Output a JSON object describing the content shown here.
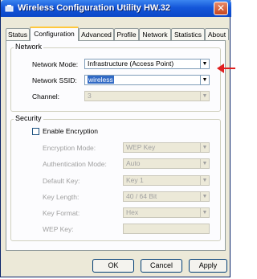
{
  "window": {
    "title": "Wireless Configuration Utility HW.32",
    "close_label": "✕"
  },
  "tabs": [
    {
      "label": "Status",
      "active": false
    },
    {
      "label": "Configuration",
      "active": true
    },
    {
      "label": "Advanced",
      "active": false
    },
    {
      "label": "Profile",
      "active": false
    },
    {
      "label": "Network",
      "active": false
    },
    {
      "label": "Statistics",
      "active": false
    },
    {
      "label": "About",
      "active": false
    }
  ],
  "network": {
    "group_title": "Network",
    "mode_label": "Network Mode:",
    "mode_value": "Infrastructure (Access Point)",
    "ssid_label": "Network SSID:",
    "ssid_value": "wireless",
    "channel_label": "Channel:",
    "channel_value": "3"
  },
  "security": {
    "group_title": "Security",
    "encryption_label": "Enable Encryption",
    "encryption_checked": false,
    "encryption_mode_label": "Encryption Mode:",
    "encryption_mode_value": "WEP Key",
    "auth_mode_label": "Authentication Mode:",
    "auth_mode_value": "Auto",
    "default_key_label": "Default Key:",
    "default_key_value": "Key 1",
    "key_length_label": "Key Length:",
    "key_length_value": "40 / 64 Bit",
    "key_format_label": "Key Format:",
    "key_format_value": "Hex",
    "wep_key_label": "WEP Key:",
    "wep_key_value": ""
  },
  "buttons": {
    "ok": "OK",
    "cancel": "Cancel",
    "apply": "Apply"
  },
  "colors": {
    "titlebar": "#0b47c8",
    "pointer": "#e02020"
  },
  "icons": {
    "title": "network-adapter-icon",
    "dropdown": "chevron-down-icon",
    "pointer": "red-arrow-icon"
  }
}
